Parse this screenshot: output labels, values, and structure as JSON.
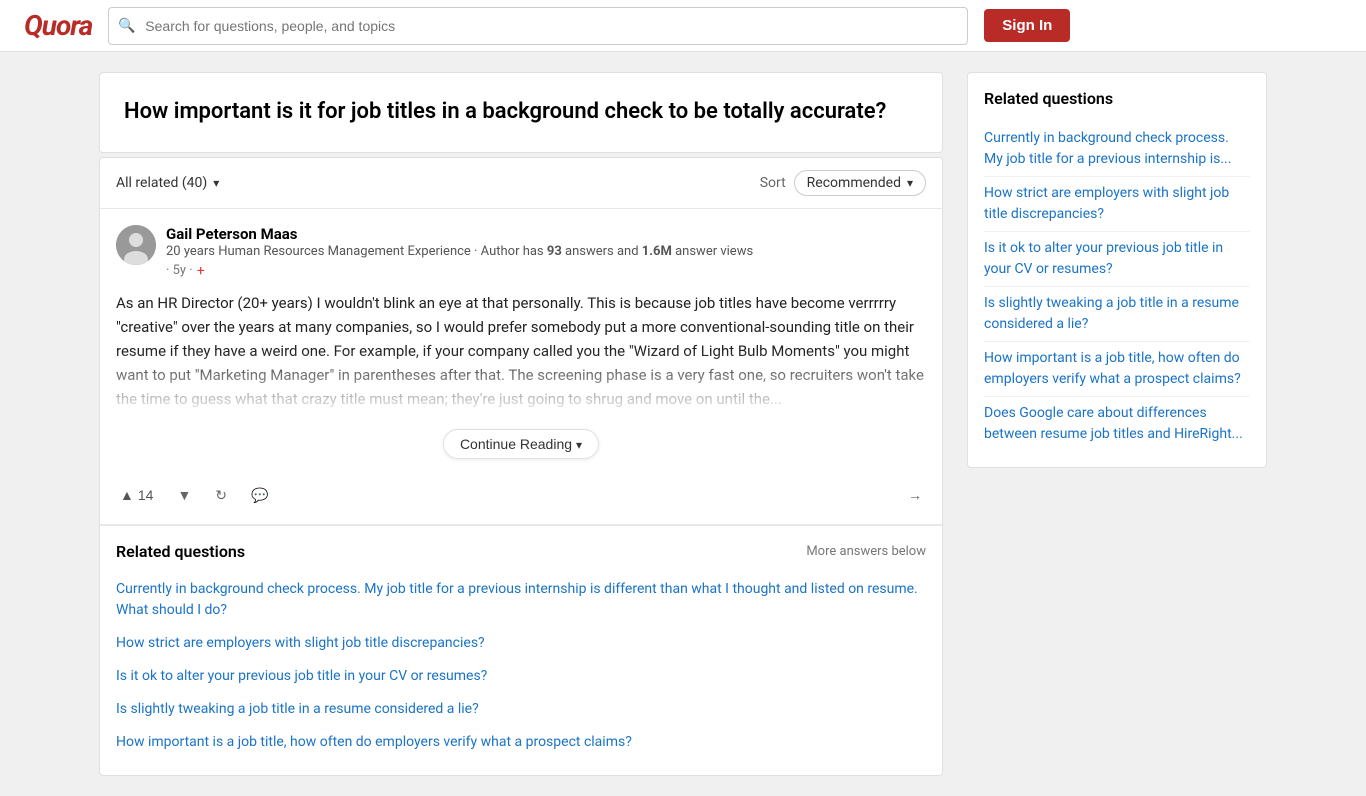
{
  "header": {
    "logo": "Quora",
    "search_placeholder": "Search for questions, people, and topics",
    "sign_in_label": "Sign In"
  },
  "main": {
    "question_title": "How important is it for job titles in a background check to be totally accurate?",
    "answers_filter": {
      "label": "All related (40)",
      "sort_label": "Sort",
      "sort_value": "Recommended"
    },
    "answer": {
      "author_name": "Gail Peterson Maas",
      "author_bio_prefix": "20 years Human Resources Management Experience · Author has ",
      "author_answers_count": "93",
      "author_bio_mid": " answers and ",
      "author_views_count": "1.6M",
      "author_bio_suffix": " answer views",
      "author_meta": "· 5y ·",
      "answer_text": "As an HR Director (20+ years) I wouldn't blink an eye at that personally. This is because job titles have become verrrrry \"creative\" over the years at many companies, so I would prefer somebody put a more conventional-sounding title on their resume if they have a weird one. For example, if your company called you the \"Wizard of Light Bulb Moments\" you might want to put \"Marketing Manager\" in parentheses after that. The screening phase is a very fast one, so recruiters won't take the time to guess what that crazy title must mean; they're just going to shrug and move on until the...",
      "vote_count": "14",
      "continue_reading_label": "Continue Reading"
    },
    "inline_related": {
      "title": "Related questions",
      "more_label": "More answers below",
      "links": [
        "Currently in background check process. My job title for a previous internship is different than what I thought and listed on resume. What should I do?",
        "How strict are employers with slight job title discrepancies?",
        "Is it ok to alter your previous job title in your CV or resumes?",
        "Is slightly tweaking a job title in a resume considered a lie?",
        "How important is a job title, how often do employers verify what a prospect claims?"
      ]
    }
  },
  "sidebar": {
    "title": "Related questions",
    "links": [
      "Currently in background check process. My job title for a previous internship is...",
      "How strict are employers with slight job title discrepancies?",
      "Is it ok to alter your previous job title in your CV or resumes?",
      "Is slightly tweaking a job title in a resume considered a lie?",
      "How important is a job title, how often do employers verify what a prospect claims?",
      "Does Google care about differences between resume job titles and HireRight..."
    ]
  }
}
